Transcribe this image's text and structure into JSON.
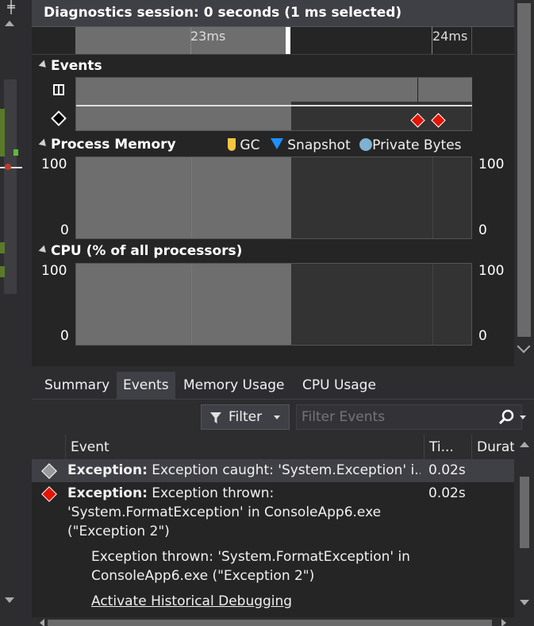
{
  "header": {
    "title": "Diagnostics session: 0 seconds (1 ms selected)"
  },
  "ruler": {
    "ticks": [
      "23ms",
      "24ms"
    ]
  },
  "sections": {
    "events": {
      "title": "Events"
    },
    "process_memory": {
      "title": "Process Memory",
      "legend": {
        "gc": "GC",
        "snapshot": "Snapshot",
        "private_bytes": "Private Bytes"
      },
      "y_max": "100",
      "y_min": "0"
    },
    "cpu": {
      "title": "CPU (% of all processors)",
      "y_max": "100",
      "y_min": "0"
    }
  },
  "tabs": [
    "Summary",
    "Events",
    "Memory Usage",
    "CPU Usage"
  ],
  "active_tab": "Events",
  "filter": {
    "label": "Filter",
    "placeholder": "Filter Events"
  },
  "table": {
    "columns": {
      "event": "Event",
      "time": "Ti...",
      "duration": "Durat"
    },
    "rows": [
      {
        "kind": "Exception:",
        "text": "Exception caught: 'System.Exception' i...",
        "time": "0.02s",
        "icon_color": "#9a9a9a"
      },
      {
        "kind": "Exception:",
        "text_line1": "Exception thrown:",
        "text_line2": "'System.FormatException' in ConsoleApp6.exe",
        "text_line3": "(\"Exception 2\")",
        "time": "0.02s",
        "icon_color": "#e51400",
        "detail_line1": "Exception thrown: 'System.FormatException' in",
        "detail_line2": "ConsoleApp6.exe (\"Exception 2\")",
        "action": "Activate Historical Debugging"
      }
    ]
  },
  "colors": {
    "gc": "#f5c542",
    "snapshot": "#1e90ff",
    "private_bytes": "#7fb2d1",
    "event_marker": "#e51400"
  }
}
